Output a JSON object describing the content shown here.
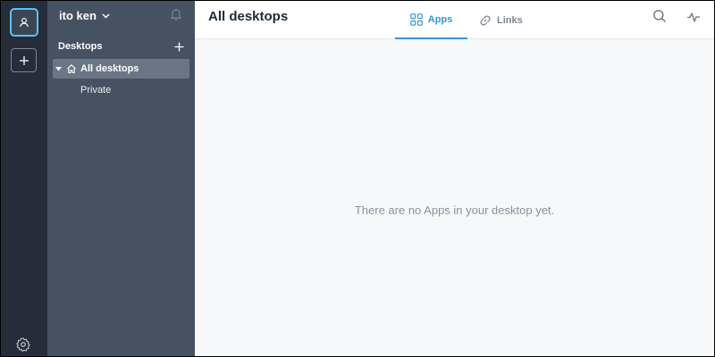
{
  "user": {
    "name": "ito ken"
  },
  "sidebar": {
    "desktops_title": "Desktops",
    "items": [
      {
        "label": "All desktops",
        "selected": true,
        "icon": "home-icon"
      },
      {
        "label": "Private"
      }
    ]
  },
  "main": {
    "title": "All desktops",
    "tabs": [
      {
        "label": "Apps",
        "icon": "apps-grid-icon",
        "active": true
      },
      {
        "label": "Links",
        "icon": "link-icon"
      }
    ],
    "empty_message": "There are no Apps in your desktop yet."
  },
  "colors": {
    "accent": "#2a9ad6",
    "rail_bg": "#242d39",
    "sidebar_bg": "#465261",
    "selected_item_bg": "#6a7686",
    "main_bg": "#f6f8fa"
  }
}
